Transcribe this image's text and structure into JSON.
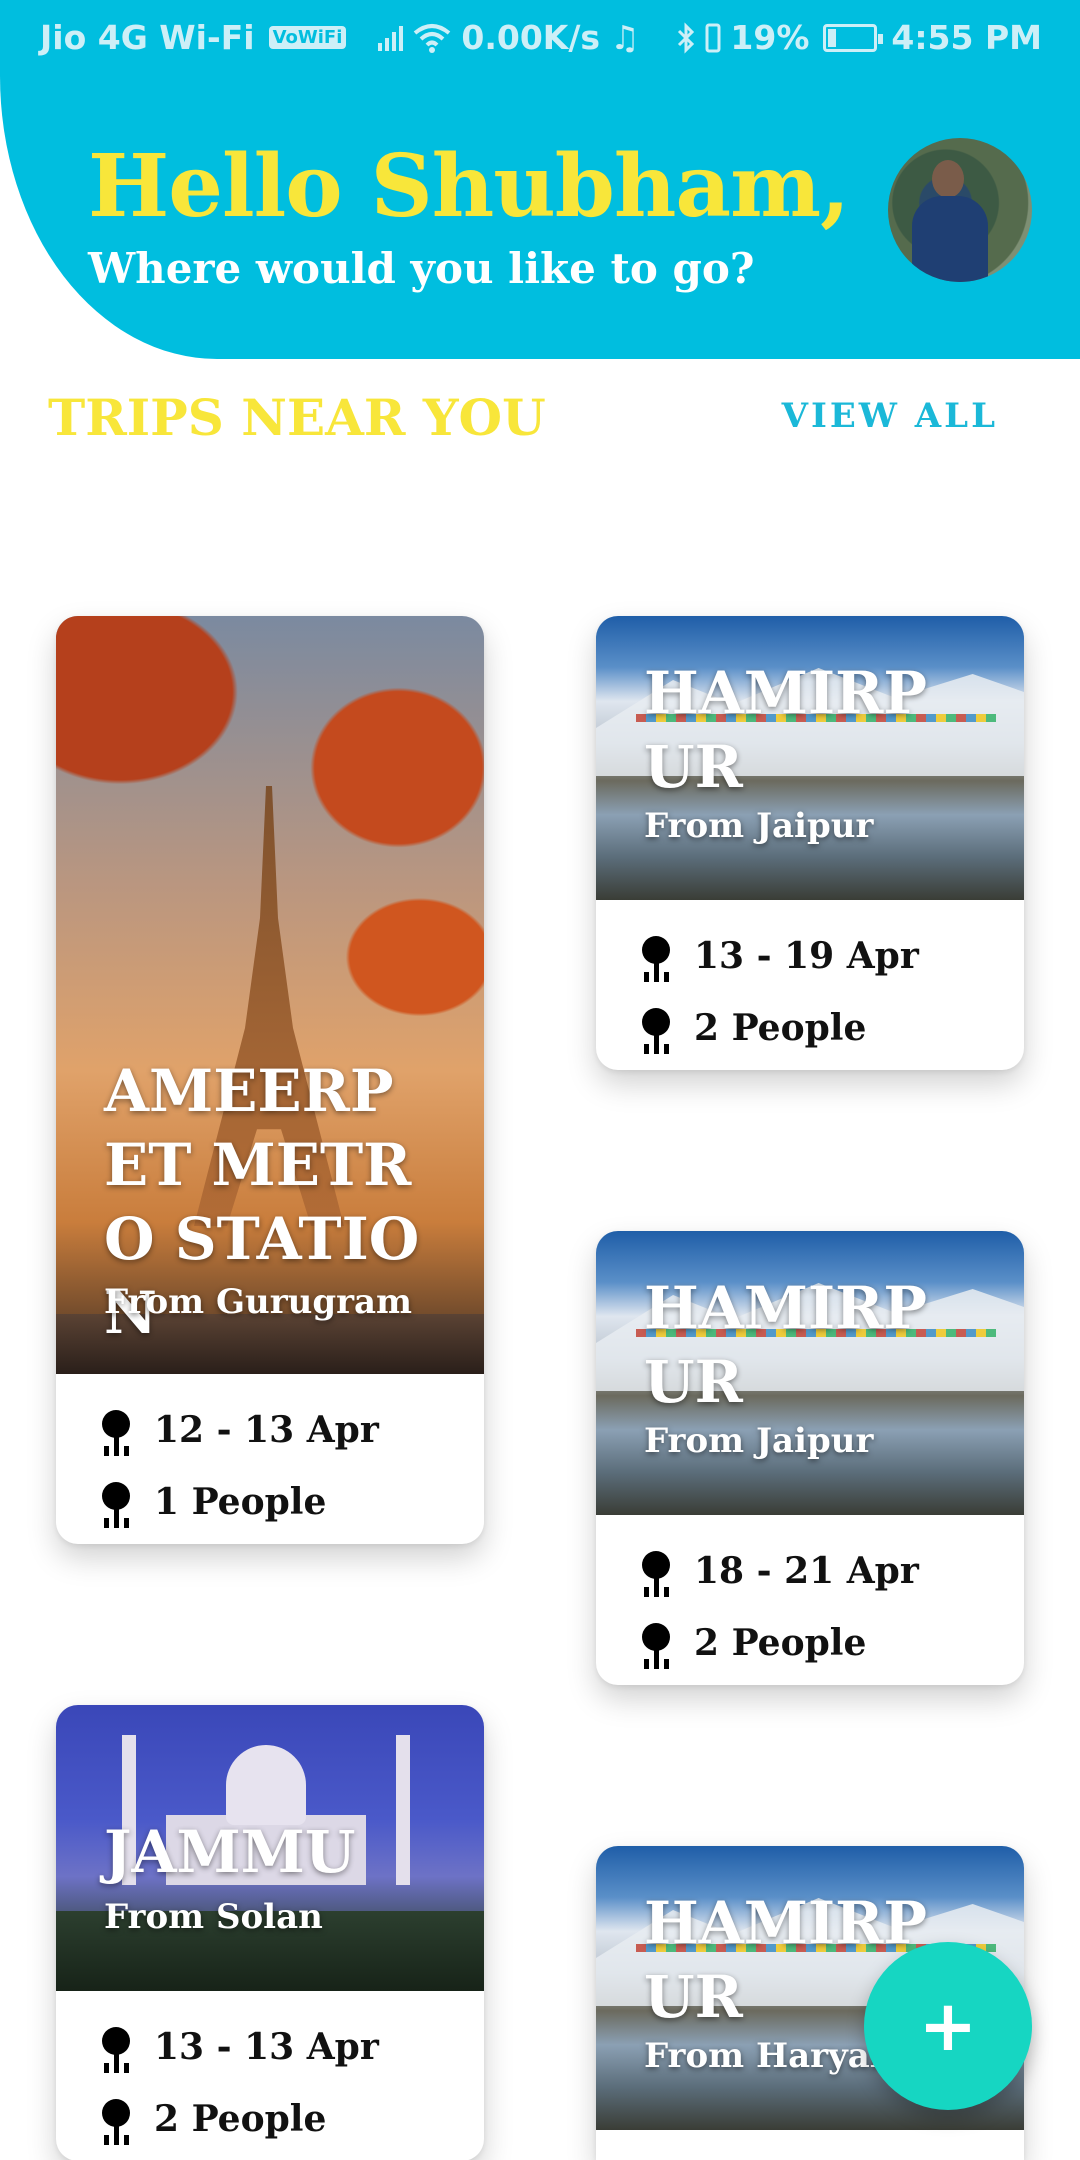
{
  "status_bar": {
    "carrier": "Jio 4G Wi-Fi",
    "volte": "VoWiFi",
    "speed": "0.00K/s",
    "music_icon": "♫",
    "battery_percent": "19%",
    "battery_level": 0.19,
    "time": "4:55 PM"
  },
  "header": {
    "greeting": "Hello Shubham,",
    "subtitle": "Where would you like to go?"
  },
  "section": {
    "title": "TRIPS NEAR YOU",
    "view_all": "VIEW ALL"
  },
  "trips": [
    {
      "title": "AMEERPET METRO STATION",
      "from": "From Gurugram",
      "dates": "12 - 13 Apr",
      "people": "1 People"
    },
    {
      "title": "HAMIRPUR",
      "from": "From Jaipur",
      "dates": "13 - 19 Apr",
      "people": "2 People"
    },
    {
      "title": "HAMIRPUR",
      "from": "From Jaipur",
      "dates": "18 - 21 Apr",
      "people": "2 People"
    },
    {
      "title": "JAMMU",
      "from": "From Solan",
      "dates": "13 - 13 Apr",
      "people": "2 People"
    },
    {
      "title": "HAMIRPUR",
      "from": "From Haryana"
    }
  ],
  "fab": {
    "label": "+"
  },
  "colors": {
    "primary": "#00bedf",
    "accent_yellow": "#f8e63a",
    "fab": "#16d6c2"
  }
}
